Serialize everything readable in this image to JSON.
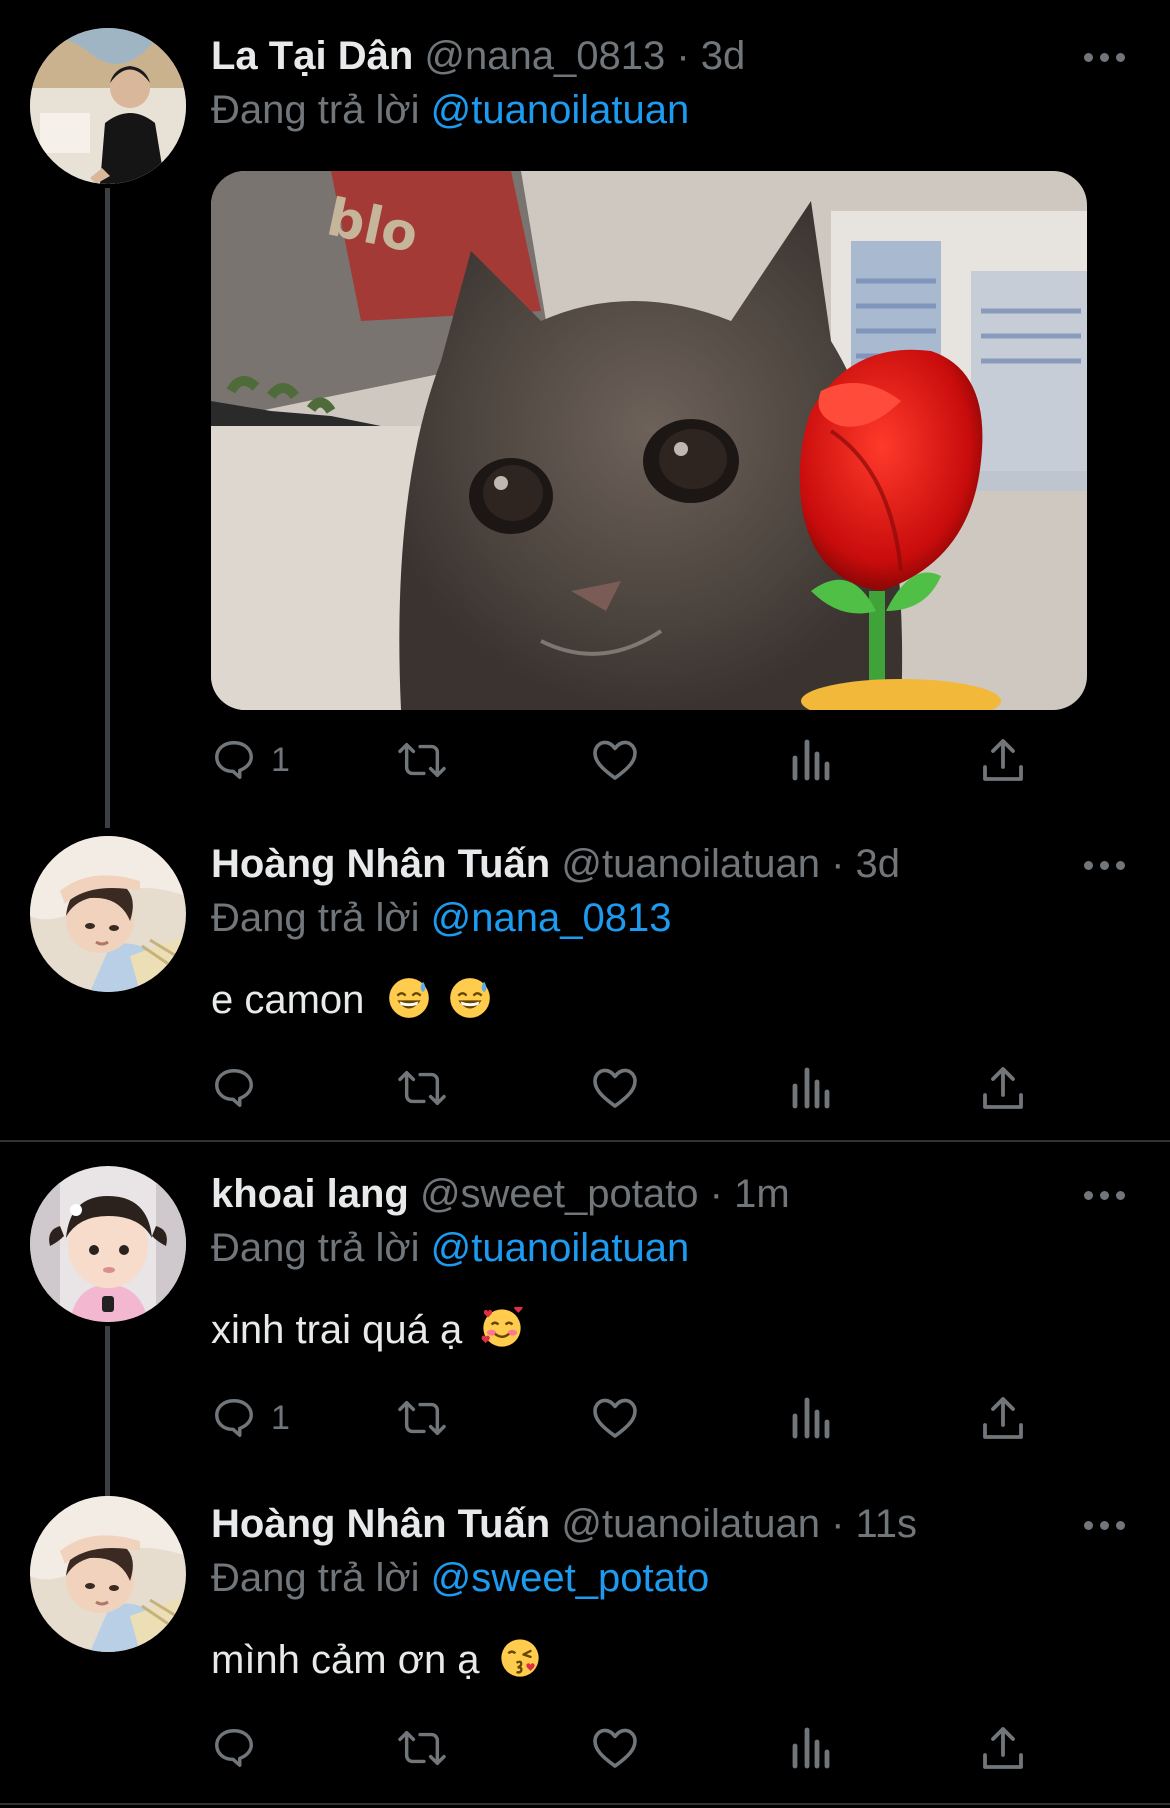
{
  "tweets": [
    {
      "name": "La Tại Dân",
      "handle": "@nana_0813",
      "time": "3d",
      "reply_label": "Đang trả lời",
      "reply_to": "@tuanoilatuan",
      "text": "",
      "has_media": true,
      "replies": "1",
      "avatar_icon": "avatar-photo-man-black-shirt"
    },
    {
      "name": "Hoàng Nhân Tuấn",
      "handle": "@tuanoilatuan",
      "time": "3d",
      "reply_label": "Đang trả lời",
      "reply_to": "@nana_0813",
      "text": "e camon",
      "emojis": [
        "grinning-sweat-emoji",
        "grinning-sweat-emoji"
      ],
      "replies": "",
      "avatar_icon": "avatar-photo-boy-lying"
    },
    {
      "name": "khoai lang",
      "handle": "@sweet_potato",
      "time": "1m",
      "reply_label": "Đang trả lời",
      "reply_to": "@tuanoilatuan",
      "text": "xinh trai quá ạ",
      "emojis": [
        "smiling-hearts-emoji"
      ],
      "replies": "1",
      "avatar_icon": "avatar-photo-baby-girl"
    },
    {
      "name": "Hoàng Nhân Tuấn",
      "handle": "@tuanoilatuan",
      "time": "11s",
      "reply_label": "Đang trả lời",
      "reply_to": "@sweet_potato",
      "text": "mình cảm ơn ạ",
      "emojis": [
        "kissing-heart-emoji"
      ],
      "replies": "",
      "avatar_icon": "avatar-photo-boy-lying"
    }
  ],
  "media": {
    "description_icon": "kitten-with-rose-image",
    "text_on_book": "blo"
  },
  "colors": {
    "background": "#000000",
    "primary_text": "#e7e9ea",
    "secondary_text": "#71767b",
    "accent": "#1d9bf0",
    "divider": "#2f3336"
  }
}
